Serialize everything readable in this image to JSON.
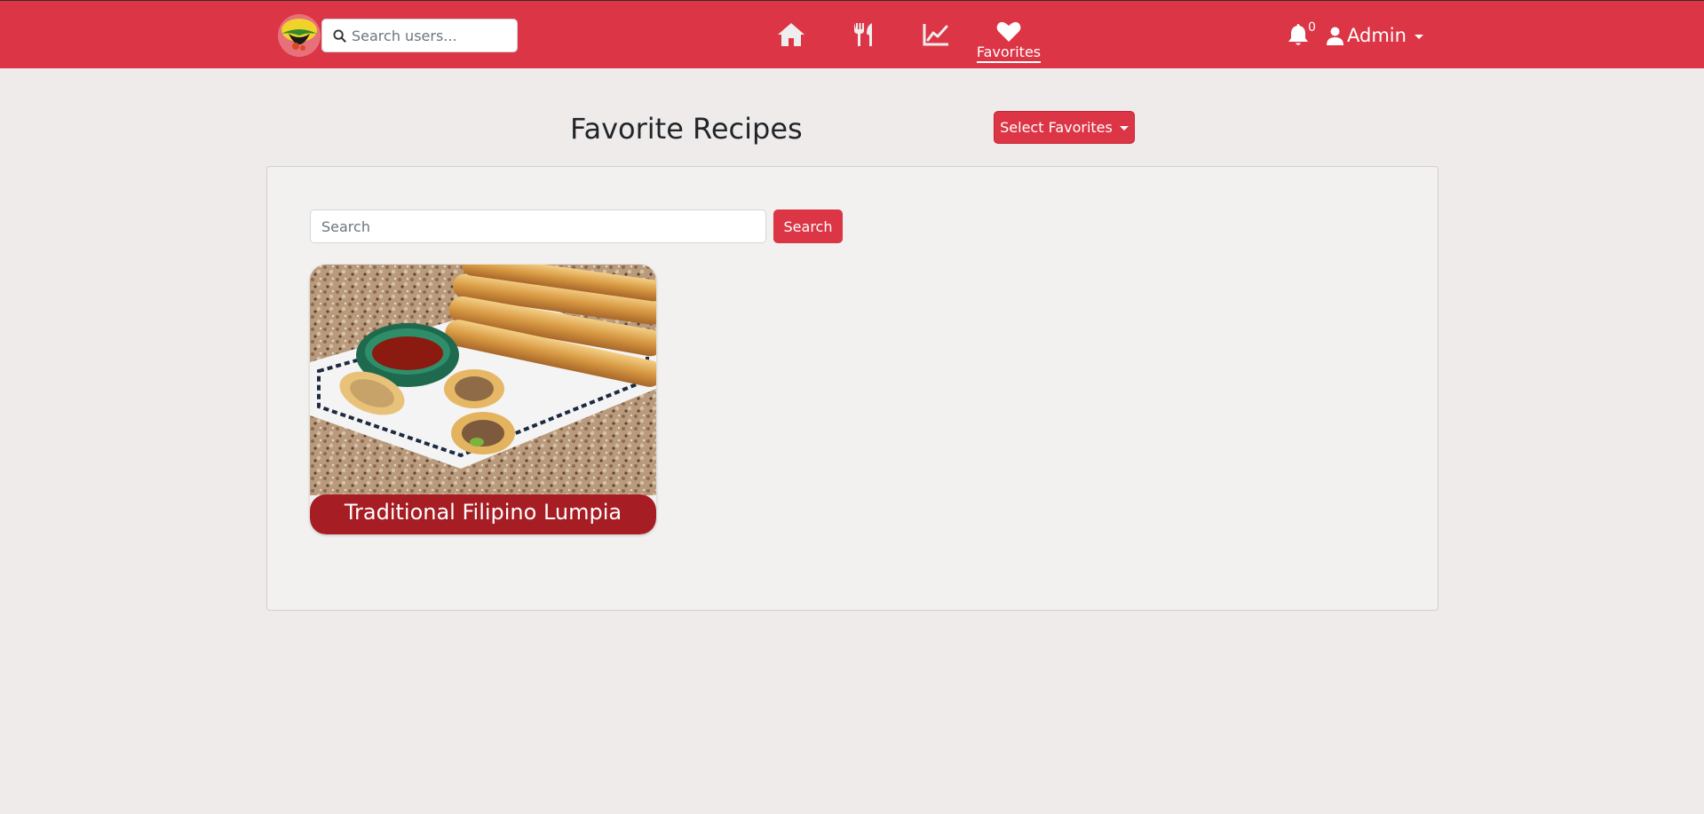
{
  "navbar": {
    "user_search_placeholder": "Search users...",
    "favorites_label": "Favorites",
    "notification_count": "0",
    "user_name": "Admin",
    "accent_color": "#dc3545"
  },
  "page": {
    "title": "Favorite Recipes",
    "select_favorites_label": "Select Favorites"
  },
  "recipe_search": {
    "placeholder": "Search",
    "button_label": "Search"
  },
  "recipes": [
    {
      "title": "Traditional Filipino Lumpia",
      "image": "lumpia-photo"
    }
  ]
}
